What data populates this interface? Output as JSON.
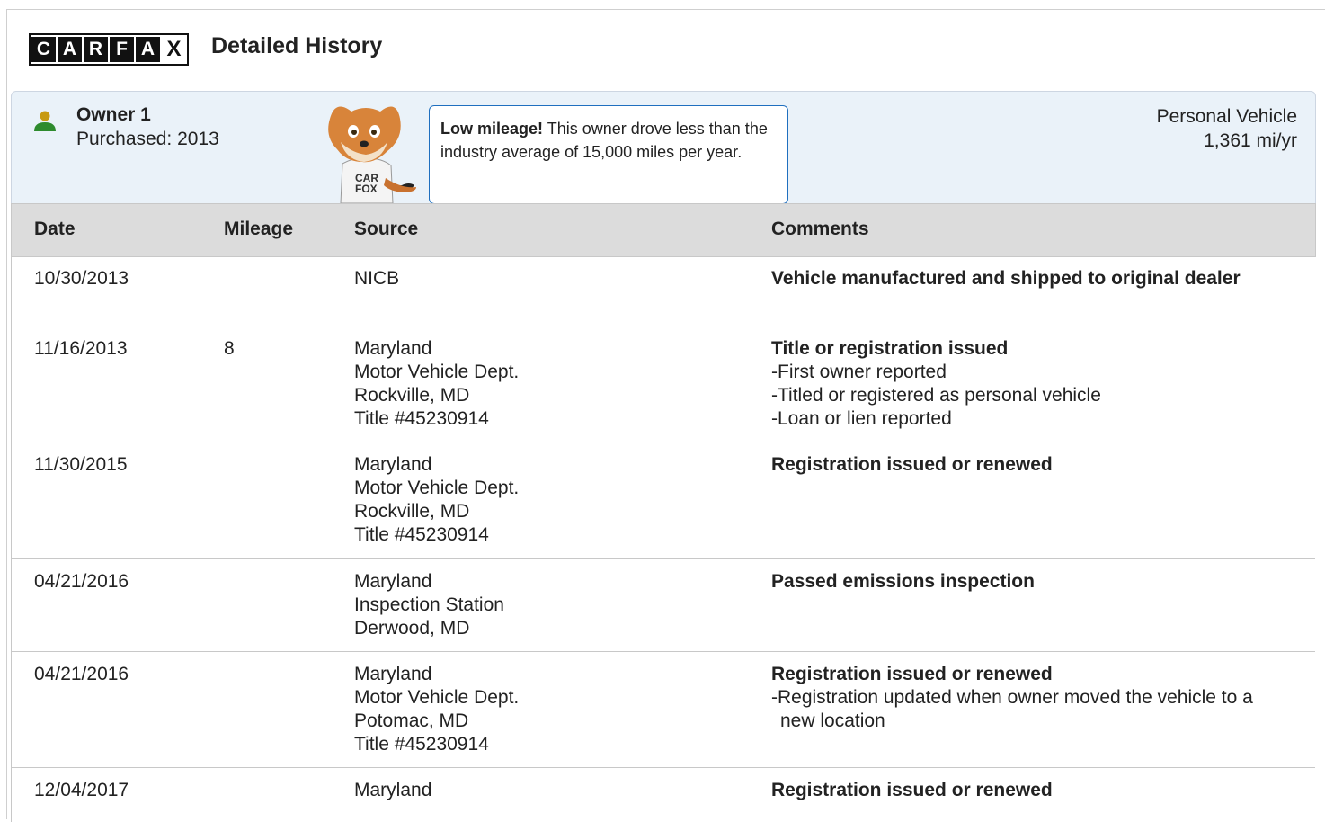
{
  "header": {
    "logo_letters": [
      "C",
      "A",
      "R",
      "F",
      "A",
      "X"
    ],
    "title": "Detailed History"
  },
  "owner": {
    "name": "Owner 1",
    "purchased": "Purchased: 2013",
    "tip_bold": "Low mileage!",
    "tip_text": " This owner drove less than the industry average of 15,000 miles per year.",
    "type": "Personal Vehicle",
    "mileage_rate": "1,361 mi/yr",
    "icon": "person-icon",
    "icon_colors": {
      "head": "#c79a12",
      "body": "#2e8b2e"
    }
  },
  "table": {
    "headers": {
      "date": "Date",
      "mileage": "Mileage",
      "source": "Source",
      "comments": "Comments"
    },
    "rows": [
      {
        "date": "10/30/2013",
        "mileage": "",
        "source": [
          "NICB"
        ],
        "comment_title": "Vehicle manufactured and shipped to original dealer",
        "comment_items": []
      },
      {
        "date": "11/16/2013",
        "mileage": "8",
        "source": [
          "Maryland",
          "Motor Vehicle Dept.",
          "Rockville, MD",
          "Title #45230914"
        ],
        "comment_title": "Title or registration issued",
        "comment_items": [
          "-First owner reported",
          "-Titled or registered as personal vehicle",
          "-Loan or lien reported"
        ]
      },
      {
        "date": "11/30/2015",
        "mileage": "",
        "source": [
          "Maryland",
          "Motor Vehicle Dept.",
          "Rockville, MD",
          "Title #45230914"
        ],
        "comment_title": "Registration issued or renewed",
        "comment_items": []
      },
      {
        "date": "04/21/2016",
        "mileage": "",
        "source": [
          "Maryland",
          "Inspection Station",
          "Derwood, MD"
        ],
        "comment_title": "Passed emissions inspection",
        "comment_items": []
      },
      {
        "date": "04/21/2016",
        "mileage": "",
        "source": [
          "Maryland",
          "Motor Vehicle Dept.",
          "Potomac, MD",
          "Title #45230914"
        ],
        "comment_title": "Registration issued or renewed",
        "comment_items": [
          "-Registration updated when owner moved the vehicle to a new location"
        ]
      },
      {
        "date": "12/04/2017",
        "mileage": "",
        "source": [
          "Maryland"
        ],
        "comment_title": "Registration issued or renewed",
        "comment_items": []
      }
    ]
  }
}
